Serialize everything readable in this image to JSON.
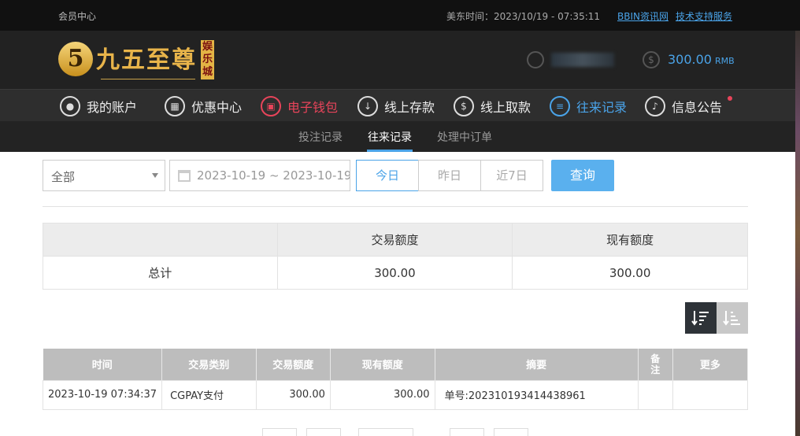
{
  "topbar": {
    "member_center": "会员中心",
    "time_label": "美东时间：2023/10/19 - 07:35:11",
    "link_bbin": "BBIN资讯网",
    "link_support": "技术支持服务"
  },
  "header": {
    "logo_digit": "5",
    "logo_name": "九五至尊",
    "logo_tag": "娱乐城",
    "balance": "300.00",
    "balance_unit": "RMB"
  },
  "nav": {
    "items": [
      {
        "label": "我的账户",
        "icon": "user-icon"
      },
      {
        "label": "优惠中心",
        "icon": "gift-icon"
      },
      {
        "label": "电子钱包",
        "icon": "wallet-icon"
      },
      {
        "label": "线上存款",
        "icon": "deposit-icon"
      },
      {
        "label": "线上取款",
        "icon": "withdraw-icon"
      },
      {
        "label": "往来记录",
        "icon": "record-icon"
      },
      {
        "label": "信息公告",
        "icon": "bell-icon"
      }
    ]
  },
  "subnav": {
    "tabs": [
      "投注记录",
      "往来记录",
      "处理中订单"
    ],
    "active": "往来记录"
  },
  "filters": {
    "type_selected": "全部",
    "date_range": "2023-10-19 ~ 2023-10-19",
    "today": "今日",
    "yesterday": "昨日",
    "last7": "近7日",
    "query": "查询"
  },
  "summary": {
    "headers": [
      "",
      "交易额度",
      "现有额度"
    ],
    "row": [
      "总计",
      "300.00",
      "300.00"
    ]
  },
  "records": {
    "headers": [
      "时间",
      "交易类别",
      "交易额度",
      "现有额度",
      "摘要",
      "备注",
      "更多"
    ],
    "rows": [
      [
        "2023-10-19 07:34:37",
        "CGPAY支付",
        "300.00",
        "300.00",
        "单号:202310193414438961",
        "",
        ""
      ]
    ]
  },
  "colors": {
    "accent_blue": "#4aa3e8",
    "accent_red": "#e8445a",
    "logo_gold": "#e8b44a",
    "dark_bg": "#222222"
  }
}
